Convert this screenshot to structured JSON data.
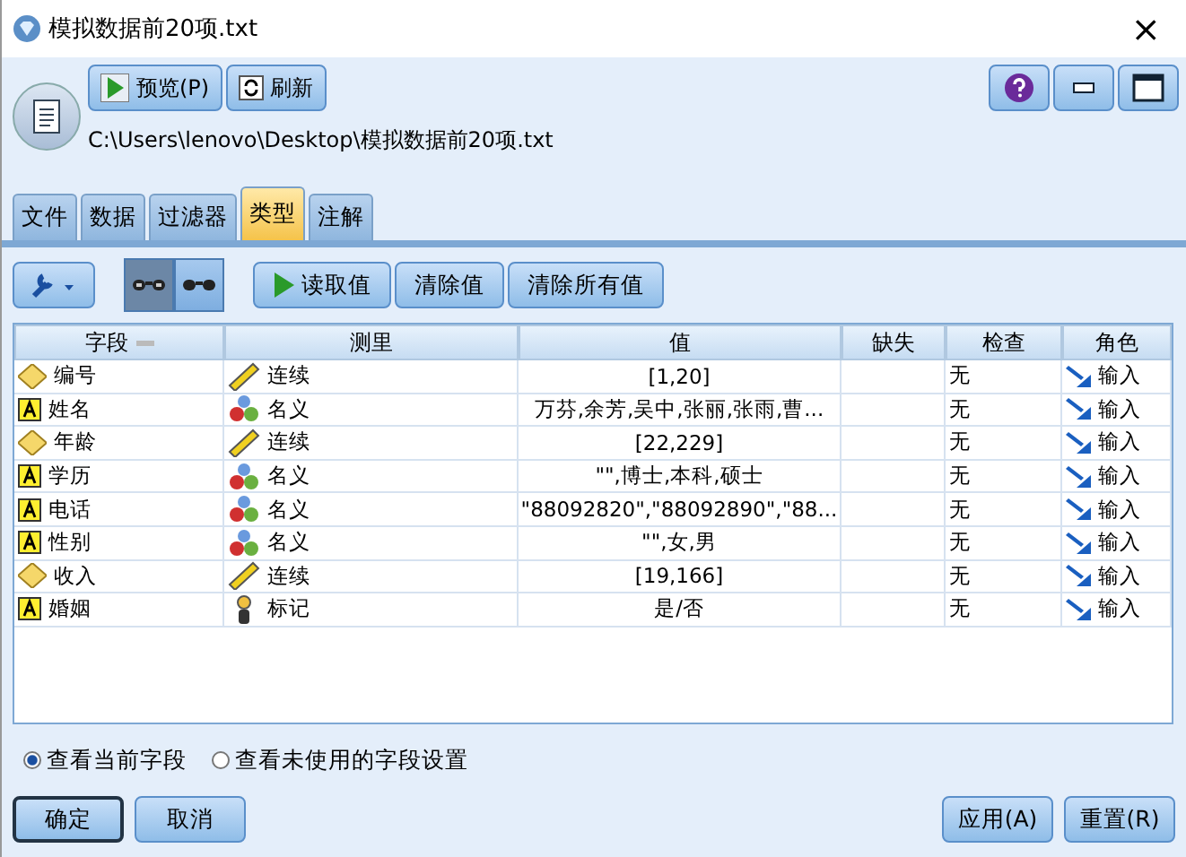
{
  "window": {
    "title": "模拟数据前20项.txt",
    "close": "×"
  },
  "header": {
    "buttons": [
      {
        "label": "预览(P)",
        "kind": "play"
      },
      {
        "label": "刷新",
        "kind": "refresh"
      }
    ],
    "path": "C:\\Users\\lenovo\\Desktop\\模拟数据前20项.txt",
    "window_buttons": [
      {
        "kind": "help"
      },
      {
        "kind": "minimize"
      },
      {
        "kind": "maximize"
      }
    ]
  },
  "tabs": [
    {
      "label": "文件",
      "selected": false
    },
    {
      "label": "数据",
      "selected": false
    },
    {
      "label": "过滤器",
      "selected": false
    },
    {
      "label": "类型",
      "selected": true
    },
    {
      "label": "注解",
      "selected": false
    }
  ],
  "toolbar": {
    "view_toggles": [
      {
        "selected": true
      },
      {
        "selected": false
      }
    ],
    "buttons": [
      {
        "label": "读取值",
        "kind": "play"
      },
      {
        "label": "清除值",
        "kind": "plain"
      },
      {
        "label": "清除所有值",
        "kind": "plain"
      }
    ]
  },
  "table": {
    "columns": [
      "字段",
      "测里",
      "值",
      "缺失",
      "检查",
      "角色"
    ],
    "rows": [
      {
        "field": {
          "label": "编号",
          "kind": "number"
        },
        "measure": {
          "label": "连续",
          "kind": "continuous"
        },
        "value": "[1,20]",
        "check": "无",
        "role": "输入"
      },
      {
        "field": {
          "label": "姓名",
          "kind": "string"
        },
        "measure": {
          "label": "名义",
          "kind": "nominal"
        },
        "value": "万芬,余芳,吴中,张丽,张雨,曹...",
        "check": "无",
        "role": "输入"
      },
      {
        "field": {
          "label": "年龄",
          "kind": "number"
        },
        "measure": {
          "label": "连续",
          "kind": "continuous"
        },
        "value": "[22,229]",
        "check": "无",
        "role": "输入"
      },
      {
        "field": {
          "label": "学历",
          "kind": "string"
        },
        "measure": {
          "label": "名义",
          "kind": "nominal"
        },
        "value": "\"\",博士,本科,硕士",
        "check": "无",
        "role": "输入"
      },
      {
        "field": {
          "label": "电话",
          "kind": "string"
        },
        "measure": {
          "label": "名义",
          "kind": "nominal"
        },
        "value": "\"88092820\",\"88092890\",\"88...",
        "check": "无",
        "role": "输入"
      },
      {
        "field": {
          "label": "性别",
          "kind": "string"
        },
        "measure": {
          "label": "名义",
          "kind": "nominal"
        },
        "value": "\"\",女,男",
        "check": "无",
        "role": "输入"
      },
      {
        "field": {
          "label": "收入",
          "kind": "number"
        },
        "measure": {
          "label": "连续",
          "kind": "continuous"
        },
        "value": "[19,166]",
        "check": "无",
        "role": "输入"
      },
      {
        "field": {
          "label": "婚姻",
          "kind": "string"
        },
        "measure": {
          "label": "标记",
          "kind": "flag"
        },
        "value": "是/否",
        "check": "无",
        "role": "输入"
      }
    ]
  },
  "radios": [
    {
      "label": "查看当前字段",
      "selected": true
    },
    {
      "label": "查看未使用的字段设置",
      "selected": false
    }
  ],
  "footer": {
    "left": [
      "确定",
      "取消"
    ],
    "right": [
      "应用(A)",
      "重置(R)"
    ]
  }
}
